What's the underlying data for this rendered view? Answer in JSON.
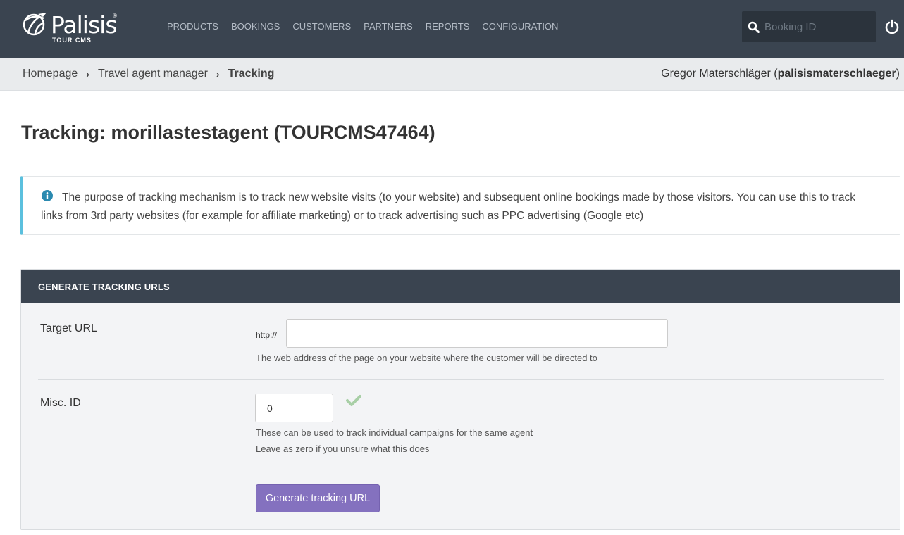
{
  "brand": {
    "name": "Palisis",
    "registered": "®",
    "sub": "TOUR CMS"
  },
  "nav": [
    "PRODUCTS",
    "BOOKINGS",
    "CUSTOMERS",
    "PARTNERS",
    "REPORTS",
    "CONFIGURATION"
  ],
  "search": {
    "placeholder": "Booking ID"
  },
  "breadcrumb": {
    "items": [
      "Homepage",
      "Travel agent manager"
    ],
    "current": "Tracking",
    "separator": "›"
  },
  "user": {
    "name": "Gregor Materschläger",
    "open": " (",
    "username": "palisismaterschlaeger",
    "close": ")"
  },
  "page": {
    "title": "Tracking: morillastestagent (TOURCMS47464)"
  },
  "info": {
    "text": "The purpose of tracking mechanism is to track new website visits (to your website) and subsequent online bookings made by those visitors. You can use this to track links from 3rd party websites (for example for affiliate marketing) or to track advertising such as PPC advertising (Google etc)"
  },
  "form": {
    "title": "GENERATE TRACKING URLS",
    "target_url": {
      "label": "Target URL",
      "prefix": "http://",
      "value": "",
      "help": "The web address of the page on your website where the customer will be directed to"
    },
    "misc_id": {
      "label": "Misc. ID",
      "value": "0",
      "help1": "These can be used to track individual campaigns for the same agent",
      "help2": "Leave as zero if you unsure what this does"
    },
    "submit_label": "Generate tracking URL"
  },
  "colors": {
    "topbar": "#3a4450",
    "info_accent": "#5bc0de",
    "button": "#8471bf",
    "check": "#a8cfa6"
  },
  "icons": {
    "logo": "palisis-globe-icon",
    "search": "search-icon",
    "power": "power-icon",
    "info": "info-circle-icon",
    "check": "checkmark-icon"
  }
}
